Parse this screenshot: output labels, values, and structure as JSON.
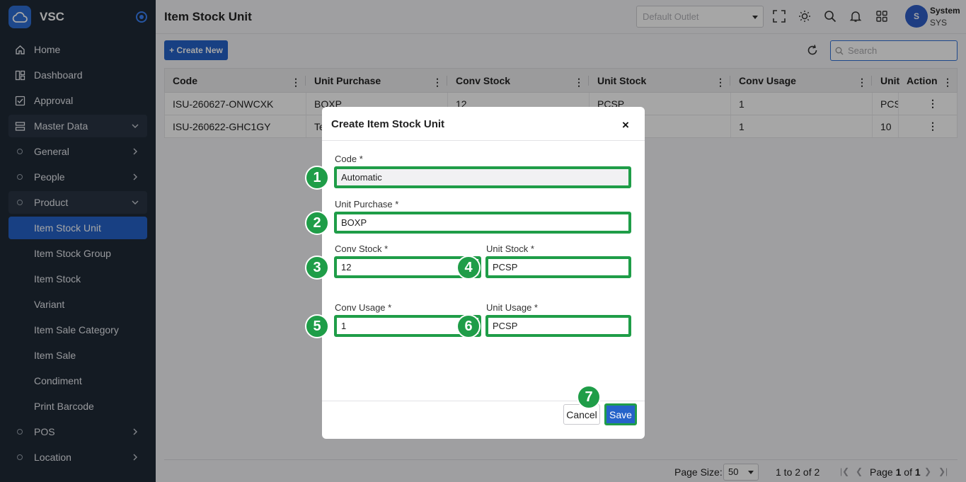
{
  "app": {
    "name": "VSC"
  },
  "header": {
    "title": "Item Stock Unit",
    "outlet_placeholder": "Default Outlet",
    "user": {
      "initial": "S",
      "name": "System",
      "code": "SYS"
    }
  },
  "sidebar": {
    "items": [
      {
        "label": "Home",
        "icon": "home-icon"
      },
      {
        "label": "Dashboard",
        "icon": "dashboard-icon"
      },
      {
        "label": "Approval",
        "icon": "approval-icon"
      },
      {
        "label": "Master Data",
        "icon": "database-icon"
      },
      {
        "label": "General"
      },
      {
        "label": "People"
      },
      {
        "label": "Product"
      },
      {
        "label": "Item Stock Unit"
      },
      {
        "label": "Item Stock Group"
      },
      {
        "label": "Item Stock"
      },
      {
        "label": "Variant"
      },
      {
        "label": "Item Sale Category"
      },
      {
        "label": "Item Sale"
      },
      {
        "label": "Condiment"
      },
      {
        "label": "Print Barcode"
      },
      {
        "label": "POS"
      },
      {
        "label": "Location"
      }
    ]
  },
  "toolbar": {
    "create_label": "+ Create New",
    "search_placeholder": "Search"
  },
  "grid": {
    "columns": [
      "Code",
      "Unit Purchase",
      "Conv Stock",
      "Unit Stock",
      "Conv Usage",
      "Unit",
      "Action"
    ],
    "rows": [
      {
        "code": "ISU-260627-ONWCXK",
        "unit_purchase": "BOXP",
        "conv_stock": "12",
        "unit_stock": "PCSP",
        "conv_usage": "1",
        "unit": "PCS"
      },
      {
        "code": "ISU-260622-GHC1GY",
        "unit_purchase": "Te",
        "conv_stock": "",
        "unit_stock": "",
        "conv_usage": "1",
        "unit": "10"
      }
    ]
  },
  "modal": {
    "title": "Create Item Stock Unit",
    "close": "×",
    "fields": {
      "code": {
        "label": "Code *",
        "value": "Automatic",
        "marker": "1"
      },
      "unit_purchase": {
        "label": "Unit Purchase *",
        "value": "BOXP",
        "marker": "2"
      },
      "conv_stock": {
        "label": "Conv Stock *",
        "value": "12",
        "marker": "3"
      },
      "unit_stock": {
        "label": "Unit Stock *",
        "value": "PCSP",
        "marker": "4"
      },
      "conv_usage": {
        "label": "Conv Usage *",
        "value": "1",
        "marker": "5"
      },
      "unit_usage": {
        "label": "Unit Usage *",
        "value": "PCSP",
        "marker": "6"
      }
    },
    "save_marker": "7",
    "cancel_label": "Cancel",
    "save_label": "Save"
  },
  "pagination": {
    "page_size_label": "Page Size:",
    "page_size": "50",
    "range": "1 to 2 of 2",
    "page_prefix": "Page ",
    "page_current": "1",
    "page_of": " of ",
    "page_total": "1"
  },
  "colors": {
    "primary": "#2563c9",
    "sidebar": "#1f2a37",
    "highlight": "#1f9d48"
  }
}
